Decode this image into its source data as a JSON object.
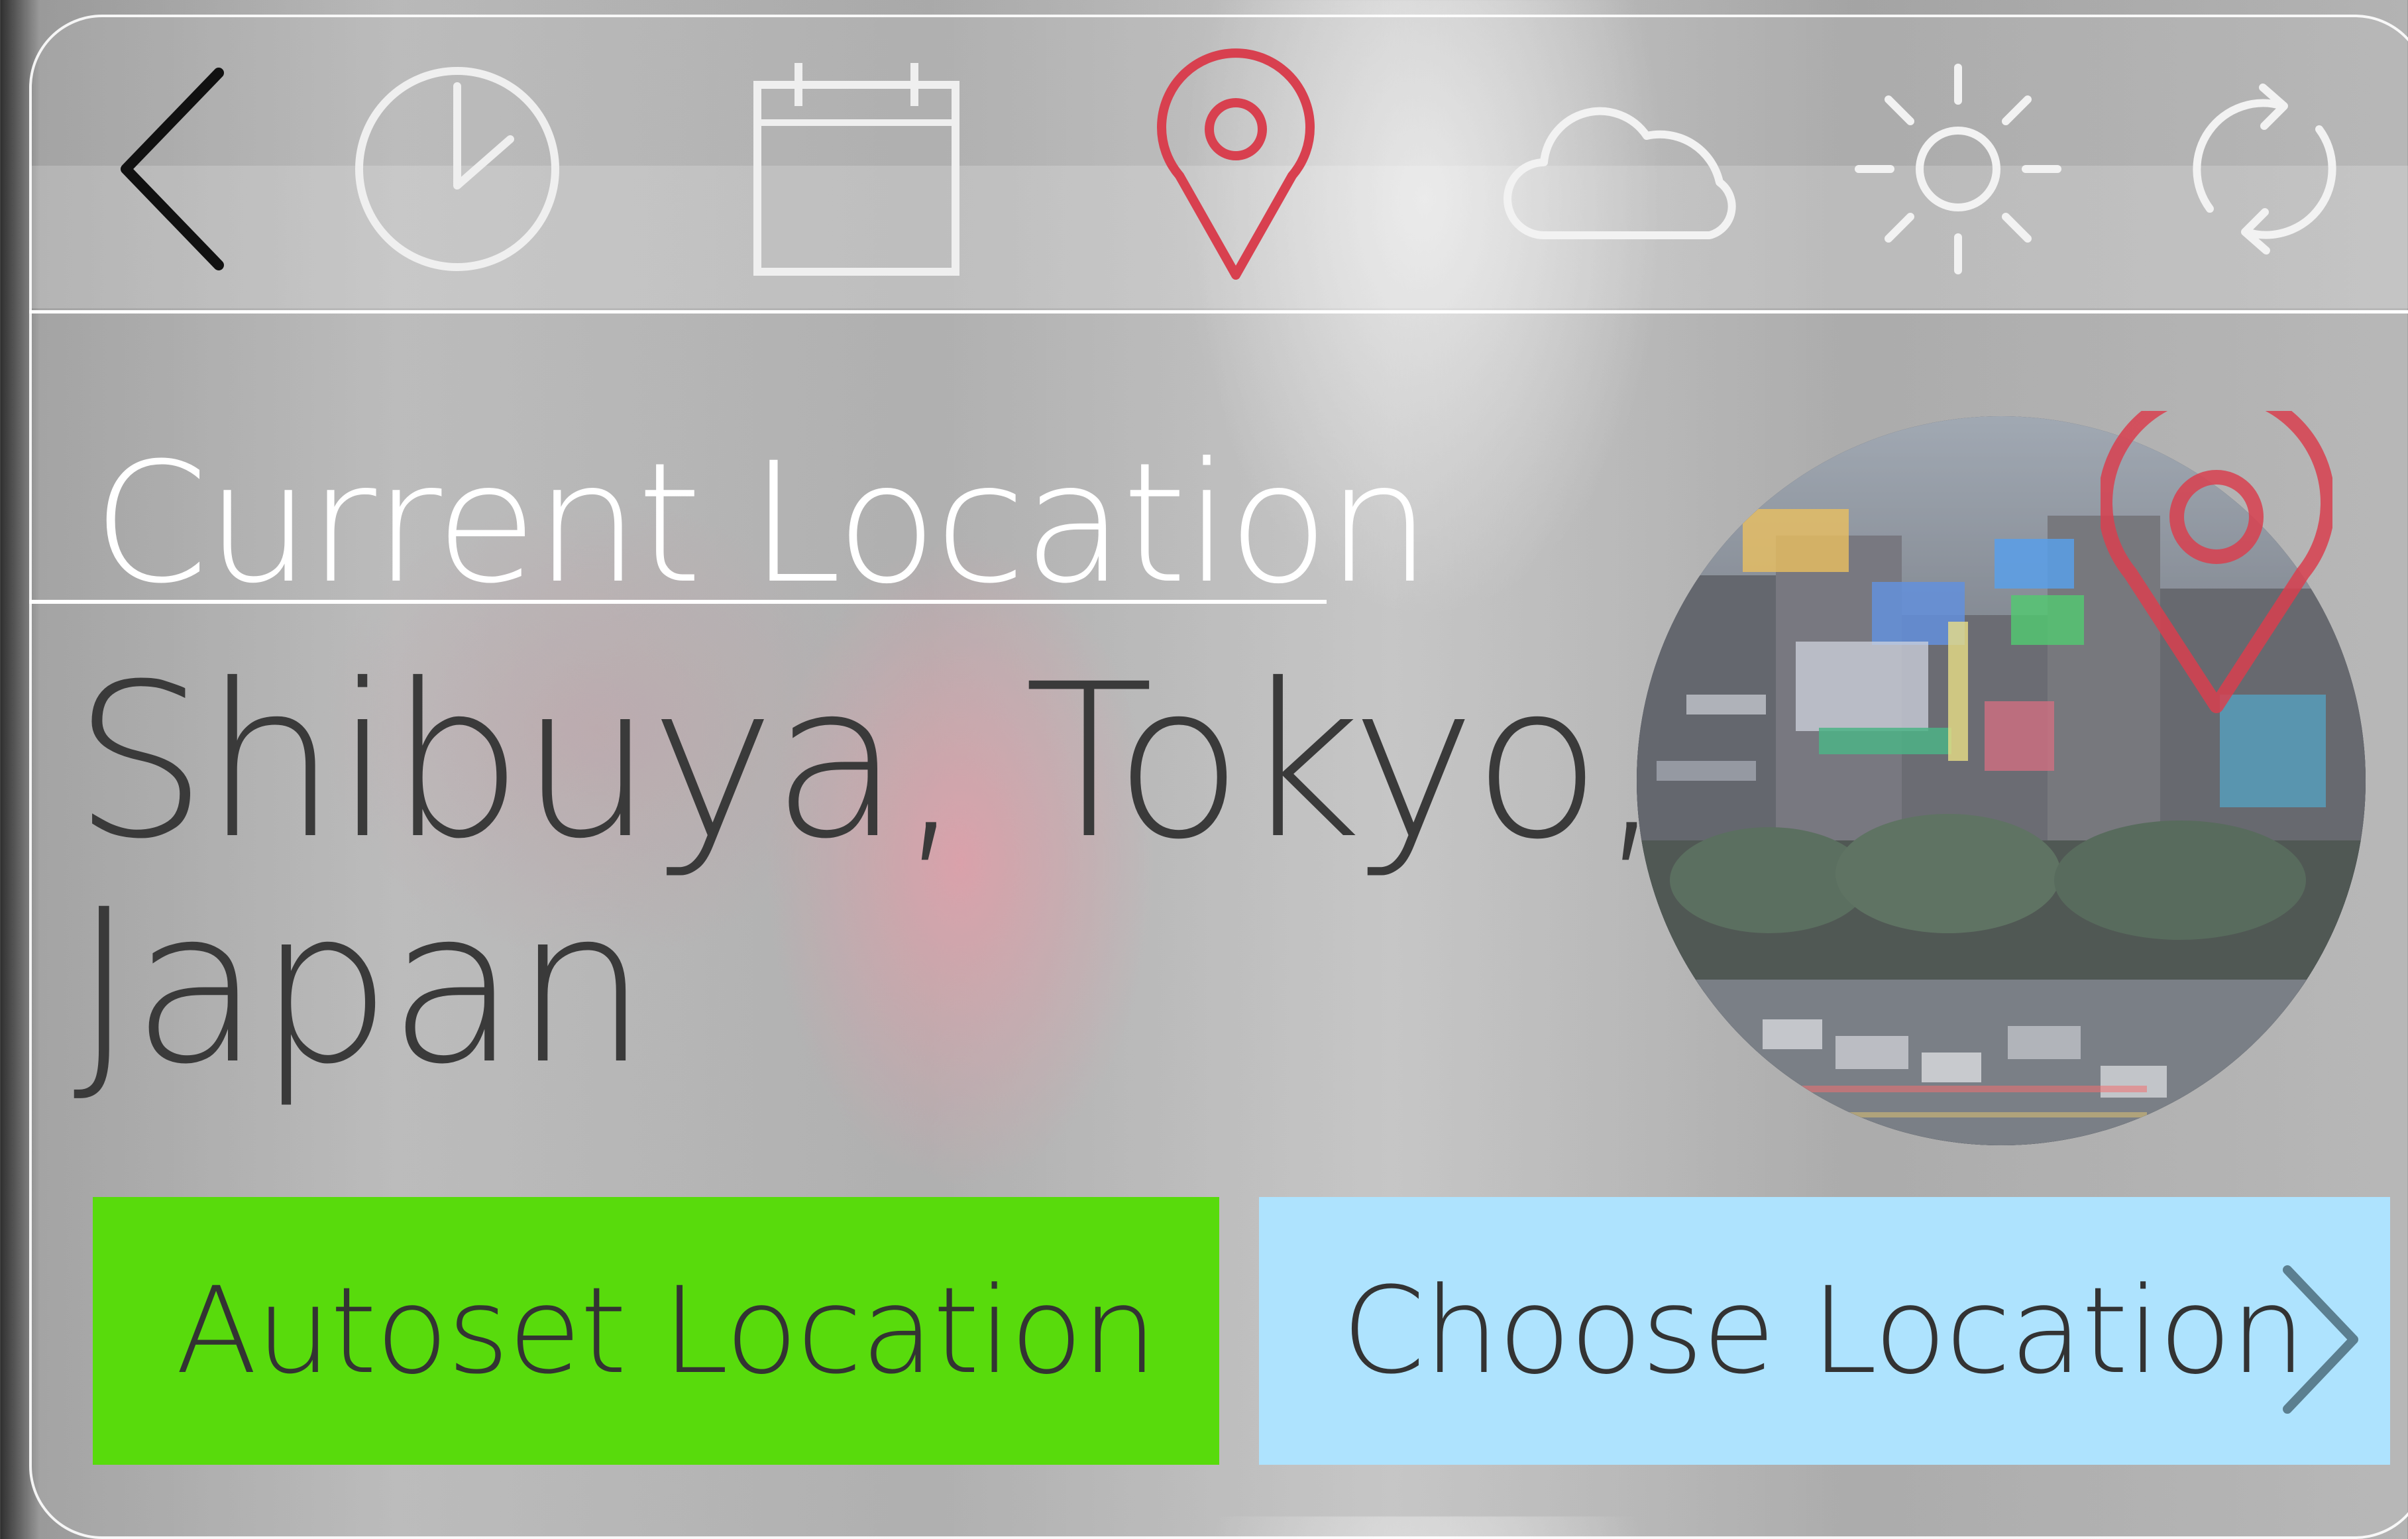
{
  "toolbar": {
    "icons": [
      "back-arrow-icon",
      "clock-icon",
      "calendar-icon",
      "location-pin-icon",
      "cloud-icon",
      "sun-icon",
      "refresh-icon"
    ],
    "active_icon": "location-pin-icon"
  },
  "location": {
    "heading": "Current Location",
    "city_line1": "Shibuya, Tokyo,",
    "city_line2": "Japan"
  },
  "actions": {
    "autoset_label": "Autoset Location",
    "choose_label": "Choose Location"
  },
  "colors": {
    "accent_red": "#d8404f",
    "autoset_bg": "#58db0c",
    "choose_bg": "#aee3fe",
    "icon_inactive": "#f2f2f2"
  }
}
